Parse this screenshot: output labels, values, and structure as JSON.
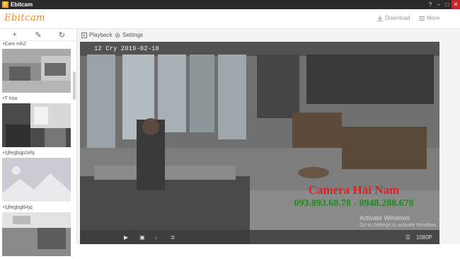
{
  "app": {
    "title": "Ebitcam",
    "logo_text": "Ebitcam"
  },
  "window_controls": {
    "help": "?",
    "minimize": "−",
    "maximize": "□",
    "close": "✕"
  },
  "header": {
    "download_label": "Download",
    "more_label": "More",
    "download_icon": "download-icon",
    "more_icon": "menu-icon"
  },
  "sidebar": {
    "tools": {
      "add": "+",
      "edit": "✎",
      "refresh": "↻"
    },
    "cameras": [
      {
        "label": "•Cam mh2"
      },
      {
        "label": "•T hòa"
      },
      {
        "label": "•1jfiegbqp2efq"
      },
      {
        "label": "•1jfiegbgl64jq"
      }
    ]
  },
  "tabs": {
    "playback": "Playback",
    "settings": "Settings"
  },
  "video": {
    "timestamp": "12 Cry  2019-02-18",
    "overlay_title": "Camera Hải Nam",
    "overlay_phone": "093.893.68.78 - 0948.288.678",
    "windows_line1": "Activate Windows",
    "windows_line2": "Go to Settings to activate Windows."
  },
  "controls": {
    "play": "▶",
    "snapshot": "▣",
    "mic": "♩",
    "ptz": "≣",
    "volume": "☰",
    "quality": "1080P"
  },
  "colors": {
    "accent": "#f08a24",
    "overlay_red": "#e02020",
    "overlay_green": "#1f8a22",
    "titlebar": "#2b2b2b"
  }
}
